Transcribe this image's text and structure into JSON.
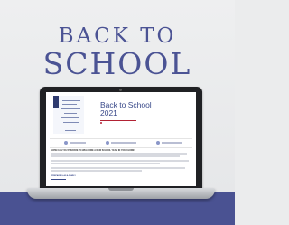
{
  "headline": {
    "line1": "BACK TO",
    "line2": "SCHOOL"
  },
  "website": {
    "title_line1": "Back to School",
    "title_line2": "2021",
    "links": [
      {
        "icon": "calendar-icon"
      },
      {
        "icon": "document-icon"
      },
      {
        "icon": "info-icon"
      }
    ],
    "section_heading": "HOW CAN YOU PREPARE TO WELCOME A NEW SCHOOL YEAR IN YOUR HOME?",
    "footer_label": "PREPARING AS A FAMILY"
  },
  "colors": {
    "brand_navy": "#4b5394",
    "band": "#4a5292",
    "accent_red": "#b22234"
  }
}
